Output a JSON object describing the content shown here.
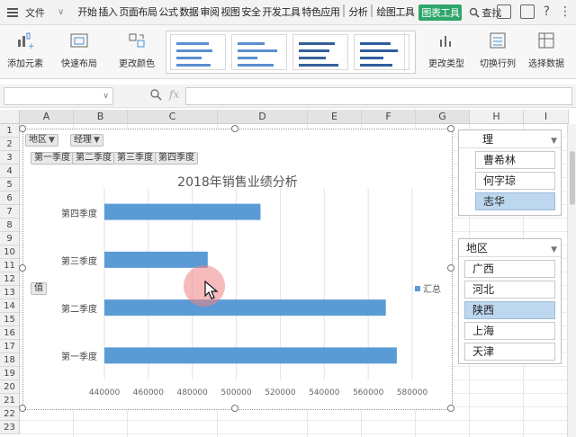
{
  "menubar": {
    "file_label": "文件",
    "tabs": [
      "开始",
      "插入",
      "页面布局",
      "公式",
      "数据",
      "审阅",
      "视图",
      "安全",
      "开发工具",
      "特色应用",
      "分析",
      "绘图工具",
      "图表工具"
    ],
    "search_label": "查找"
  },
  "ribbon": {
    "add_element": "添加元素",
    "quick_layout": "快速布局",
    "change_color": "更改颜色",
    "change_type": "更改类型",
    "switch_row_col": "切换行列",
    "select_data": "选择数据"
  },
  "formula": {
    "fx_label": "fx",
    "value": ""
  },
  "sheet": {
    "columns": [
      "A",
      "B",
      "C",
      "D",
      "E",
      "F",
      "G",
      "H",
      "I"
    ],
    "rows": [
      "1",
      "2",
      "3",
      "4",
      "5",
      "6",
      "7",
      "8",
      "9",
      "10",
      "11",
      "12",
      "13",
      "14",
      "15",
      "16",
      "17",
      "18",
      "19",
      "20",
      "21",
      "22",
      "23"
    ]
  },
  "pivot_fields": {
    "region_btn": "地区",
    "manager_btn": "经理",
    "quarters": [
      "第一季度",
      "第二季度",
      "第三季度",
      "第四季度"
    ],
    "value_btn": "值"
  },
  "chart_data": {
    "type": "bar",
    "title": "2018年销售业绩分析",
    "categories": [
      "第一季度",
      "第二季度",
      "第三季度",
      "第四季度"
    ],
    "series": [
      {
        "name": "汇总",
        "values": [
          573000,
          568000,
          487000,
          511000
        ]
      }
    ],
    "xlim": [
      440000,
      580000
    ],
    "xticks": [
      "440000",
      "460000",
      "480000",
      "500000",
      "520000",
      "540000",
      "560000",
      "580000"
    ],
    "grid": true,
    "legend": "right",
    "color": "#5b9bd5"
  },
  "slicer_manager": {
    "header": "理",
    "items": [
      "曹希林",
      "何字琼",
      "志华"
    ],
    "selected_index": 2
  },
  "slicer_region": {
    "header": "地区",
    "items": [
      "广西",
      "河北",
      "陕西",
      "上海",
      "天津"
    ],
    "selected_index": 2
  }
}
